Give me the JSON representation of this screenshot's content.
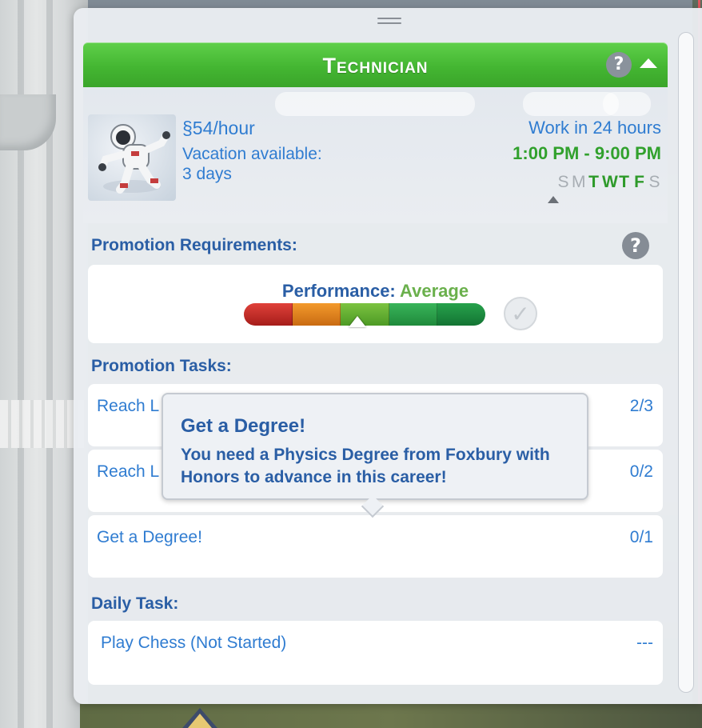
{
  "career": {
    "title": "Technician",
    "pay": "§54/hour",
    "vacation_line1": "Vacation available:",
    "vacation_line2": "3 days",
    "work_in": "Work in 24 hours",
    "hours": "1:00  PM - 9:00  PM",
    "days": [
      {
        "label": "S",
        "work": false
      },
      {
        "label": "M",
        "work": false
      },
      {
        "label": "T",
        "work": true
      },
      {
        "label": "W",
        "work": true
      },
      {
        "label": "T",
        "work": true
      },
      {
        "label": "F",
        "work": true
      },
      {
        "label": "S",
        "work": false
      }
    ],
    "help_symbol": "?"
  },
  "promotion": {
    "requirements_title": "Promotion Requirements:",
    "performance_key": "Performance: ",
    "performance_value": "Average",
    "performance_level": 0.47,
    "help_symbol": "?",
    "check_symbol": "✓"
  },
  "tasks": {
    "title": "Promotion Tasks:",
    "items": [
      {
        "label": "Reach L",
        "count": "2/3"
      },
      {
        "label": "Reach L",
        "count": "0/2"
      },
      {
        "label": "Get a Degree!",
        "count": "0/1"
      }
    ]
  },
  "daily": {
    "title": "Daily Task:",
    "task": "Play Chess (Not Started)",
    "count": "---"
  },
  "tooltip": {
    "title": "Get a Degree!",
    "body": "You need a Physics Degree from Foxbury with Honors to advance in this career!"
  },
  "colors": {
    "accent_green": "#44b632",
    "text_blue": "#2f7cd1",
    "heading_blue": "#2a5ea5"
  }
}
